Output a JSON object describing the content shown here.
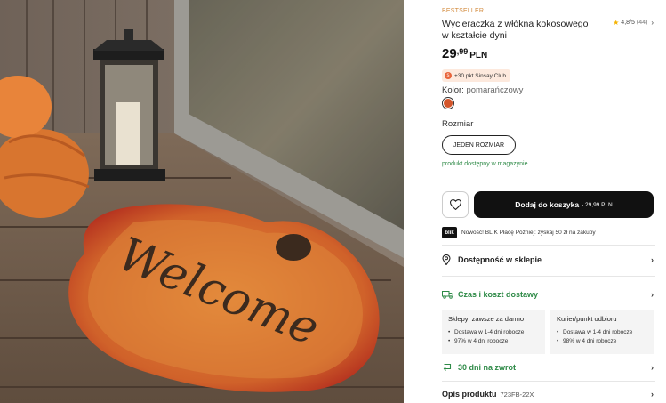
{
  "product": {
    "badge": "BESTSELLER",
    "title": "Wycieraczka z włókna kokosowego w kształcie dyni",
    "rating": "4,8/5",
    "rating_count": "(44)",
    "price_int": "29",
    "price_dec": ",99",
    "currency": "PLN",
    "club": "+30 pkt Sinsay Club",
    "color_label": "Kolor:",
    "color_value": "pomarańczowy",
    "swatch_color": "#d3552a",
    "size_label": "Rozmiar",
    "size_button": "JEDEN ROZMIAR",
    "availability": "produkt dostępny w magazynie",
    "mat_text": "Welcome"
  },
  "actions": {
    "add_to_cart": "Dodaj do koszyka",
    "cart_price": "- 29,99 PLN"
  },
  "blik": {
    "logo": "blik",
    "text": "Nowość! BLIK Płacę Później: zyskaj 50 zł na zakupy"
  },
  "sections": {
    "store": "Dostępność w sklepie",
    "delivery": "Czas i koszt dostawy",
    "returns": "30 dni na zwrot",
    "description": "Opis produktu",
    "sku": "723FB-22X"
  },
  "delivery": {
    "store_title": "Sklepy: zawsze za darmo",
    "store_items": [
      "Dostawa w 1-4 dni robocze",
      "97% w 4 dni robocze"
    ],
    "courier_title": "Kurier/punkt odbioru",
    "courier_items": [
      "Dostawa w 1-4 dni robocze",
      "98% w 4 dni robocze"
    ]
  },
  "colors": {
    "accent_green": "#2e8a47",
    "badge_orange": "#d38b3e",
    "cart_bg": "#111111"
  }
}
